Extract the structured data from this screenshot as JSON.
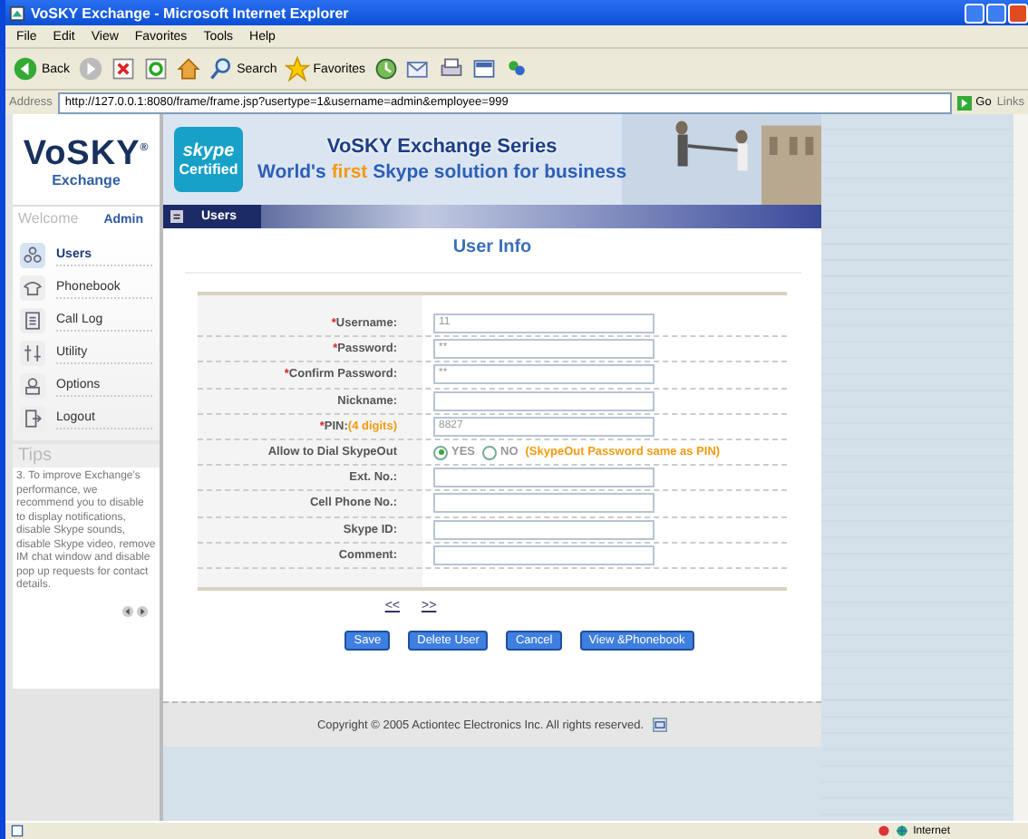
{
  "window": {
    "title": "VoSKY Exchange - Microsoft Internet Explorer"
  },
  "menu": [
    "File",
    "Edit",
    "View",
    "Favorites",
    "Tools",
    "Help"
  ],
  "toolbar": [
    {
      "kind": "back",
      "label": "Back"
    },
    {
      "kind": "forward"
    },
    {
      "kind": "stop"
    },
    {
      "kind": "refresh"
    },
    {
      "kind": "home"
    },
    {
      "kind": "search",
      "label": "Search"
    },
    {
      "kind": "favorites",
      "label": "Favorites"
    },
    {
      "kind": "history"
    },
    {
      "kind": "mail"
    },
    {
      "kind": "print"
    },
    {
      "kind": "edit"
    },
    {
      "kind": "messenger"
    }
  ],
  "address_bar": {
    "label": "Address",
    "url": "http://127.0.0.1:8080/frame/frame.jsp?usertype=1&username=admin&employee=999",
    "go": "Go",
    "links": "Links"
  },
  "logo": {
    "name": "VoSKY",
    "mark": "®",
    "product": "Exchange"
  },
  "welcome": {
    "label": "Welcome",
    "user": "Admin"
  },
  "nav": [
    {
      "label": "Users",
      "selected": true
    },
    {
      "label": "Phonebook",
      "selected": false
    },
    {
      "label": "Call Log",
      "selected": false
    },
    {
      "label": "Utility",
      "selected": false
    },
    {
      "label": "Options",
      "selected": false
    },
    {
      "label": "Logout",
      "selected": false
    }
  ],
  "tips": {
    "title": "Tips",
    "text": "3. To improve Exchange's performance, we recommend you to disable to display notifications, disable Skype sounds, disable Skype video, remove IM chat window and disable pop up requests for contact details."
  },
  "banner": {
    "badge_top": "skype",
    "badge_bottom": "Certified",
    "heading": "VoSKY Exchange Series",
    "tagline_start": "World's",
    "tagline_highlight": "first",
    "tagline_end": "Skype solution for business"
  },
  "tab": {
    "label": "Users"
  },
  "page_title": "User Info",
  "form": [
    {
      "kind": "input",
      "required_mark": "*",
      "label": "Username:",
      "value": "11"
    },
    {
      "kind": "input",
      "required_mark": "*",
      "label": "Password:",
      "value": "**"
    },
    {
      "kind": "input",
      "required_mark": "*",
      "label": "Confirm Password:",
      "value": "**"
    },
    {
      "kind": "input",
      "label": "Nickname:"
    },
    {
      "kind": "input",
      "required_mark": "*",
      "label": "PIN:",
      "hint": "(4 digits)",
      "value": "8827"
    },
    {
      "kind": "radio",
      "label": "Allow to Dial SkypeOut",
      "options": [
        {
          "label": "YES",
          "selected": true
        },
        {
          "label": "NO",
          "selected": false
        }
      ],
      "note": "(SkypeOut Password same as PIN)"
    },
    {
      "kind": "input",
      "label": "Ext. No.:"
    },
    {
      "kind": "input",
      "label": "Cell Phone No.:"
    },
    {
      "kind": "input",
      "label": "Skype ID:"
    },
    {
      "kind": "input",
      "label": "Comment:"
    }
  ],
  "pager": [
    "<<",
    ">>"
  ],
  "buttons": [
    "Save",
    "Delete User",
    "Cancel",
    "View &Phonebook"
  ],
  "footer": "Copyright © 2005 Actiontec Electronics Inc. All rights  reserved.",
  "status_bar": {
    "zone": "Internet"
  }
}
